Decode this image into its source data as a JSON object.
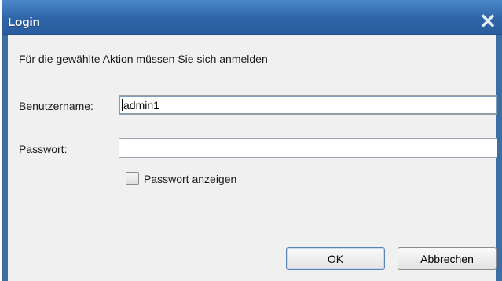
{
  "window": {
    "title": "Login",
    "close_glyph": "✕"
  },
  "prompt": "Für die gewählte Aktion müssen Sie sich anmelden",
  "form": {
    "username_label": "Benutzername:",
    "username_value": "admin1",
    "password_label": "Passwort:",
    "password_value": "",
    "show_password_label": "Passwort anzeigen",
    "show_password_checked": false
  },
  "buttons": {
    "ok_label": "OK",
    "cancel_label": "Abbrechen"
  },
  "colors": {
    "titlebar": "#2e65a8",
    "frame": "#3a6ea5",
    "dialog_bg": "#f0f0f0"
  }
}
